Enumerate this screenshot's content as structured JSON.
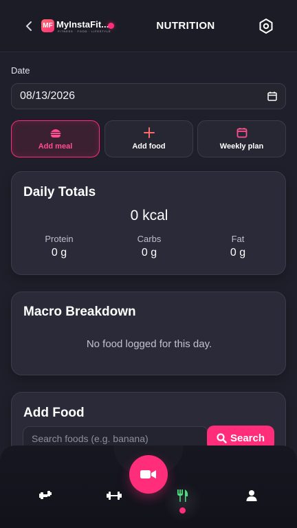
{
  "header": {
    "logo_badge": "MF",
    "logo_text": "MyInstaFit...",
    "logo_tagline": "FITNESS · FOOD · LIFESTYLE",
    "title": "NUTRITION"
  },
  "date": {
    "label": "Date",
    "value": "08/13/2026"
  },
  "actions": [
    {
      "label": "Add meal",
      "icon": "burger-icon",
      "active": true
    },
    {
      "label": "Add food",
      "icon": "plus-icon",
      "active": false
    },
    {
      "label": "Weekly plan",
      "icon": "calendar-icon",
      "active": false
    }
  ],
  "daily_totals": {
    "title": "Daily Totals",
    "kcal": "0 kcal",
    "protein_label": "Protein",
    "protein_value": "0 g",
    "carbs_label": "Carbs",
    "carbs_value": "0 g",
    "fat_label": "Fat",
    "fat_value": "0 g"
  },
  "macro_breakdown": {
    "title": "Macro Breakdown",
    "empty_text": "No food logged for this day."
  },
  "add_food": {
    "title": "Add Food",
    "search_placeholder": "Search foods (e.g. banana)",
    "search_label": "Search"
  },
  "bottom_nav": {
    "items": [
      "workout-icon",
      "dumbbell-icon",
      "fork-knife-icon",
      "user-icon"
    ],
    "active_index": 2,
    "center_button": "video-camera-icon"
  },
  "colors": {
    "accent": "#ff2d7a",
    "background": "#1f1f2b",
    "card": "#2a2a38"
  }
}
